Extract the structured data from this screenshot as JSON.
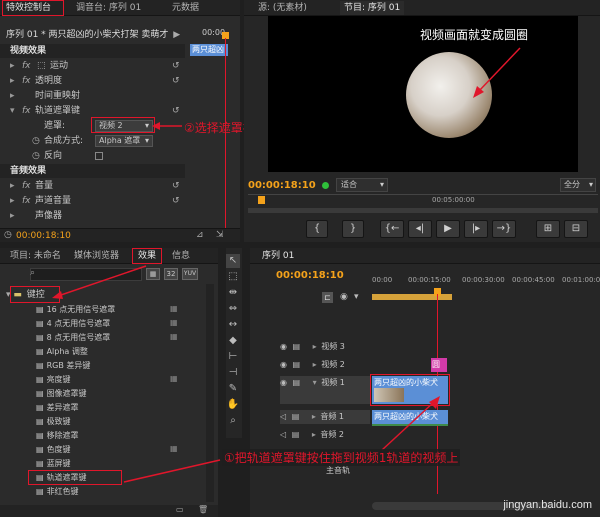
{
  "effect_controls": {
    "tabs": [
      "特效控制台",
      "调音台: 序列 01",
      "元数据"
    ],
    "sequence_label": "序列 01 * 两只超凶的小柴犬打架 卖萌才",
    "timecode_head": "00:00",
    "clip_mini_label": "两只超凶",
    "video_effects_header": "视频效果",
    "motion": "运动",
    "opacity": "透明度",
    "time_remap": "时间重映射",
    "track_matte": "轨道遮罩键",
    "matte_label": "遮罩:",
    "matte_value": "视频 2",
    "composite_label": "合成方式:",
    "composite_value": "Alpha 遮罩",
    "reverse_label": "反向",
    "audio_effects_header": "音频效果",
    "volume": "音量",
    "channel_volume": "声道音量",
    "panner": "声像器",
    "timecode": "00:00:18:10"
  },
  "source_monitor": {
    "tab": "源: (无素材)"
  },
  "program_monitor": {
    "tab": "节目: 序列 01",
    "timecode": "00:00:18:10",
    "fit": "适合",
    "ruler_mid": "00:05:00:00",
    "full": "全分"
  },
  "project_panel": {
    "tabs": [
      "项目: 未命名",
      "媒体浏览器",
      "效果",
      "信息"
    ],
    "folder": "键控",
    "badges": [
      "32",
      "YUV"
    ],
    "items": [
      "16 点无用信号遮罩",
      "4 点无用信号遮罩",
      "8 点无用信号遮罩",
      "Alpha 调整",
      "RGB 差异键",
      "亮度键",
      "图像遮罩键",
      "差异遮罩",
      "极致键",
      "移除遮罩",
      "色度键",
      "蓝屏键",
      "轨道遮罩键",
      "非红色键"
    ]
  },
  "timeline": {
    "tab": "序列 01",
    "timecode": "00:00:18:10",
    "ruler": [
      "00:00",
      "00:00:15:00",
      "00:00:30:00",
      "00:00:45:00",
      "00:01:00:00"
    ],
    "tracks": {
      "video3": "视频 3",
      "video2": "视频 2",
      "video1": "视频 1",
      "audio1": "音频 1",
      "audio2": "音频 2",
      "master": "主音轨"
    },
    "clip_v2": "圆",
    "clip_v1": "两只超凶的小柴犬",
    "clip_a1": "两只超凶的小柴犬"
  },
  "annotations": {
    "circle_note": "视频画面就变成圆圈",
    "step2": "②选择遮罩视频2",
    "step1": "①把轨道遮罩键按住拖到视频1轨道的视频上"
  },
  "watermark": "jingyan.baidu.com",
  "colors": {
    "accent_orange": "#f4a21b",
    "annotation_red": "#e0162b",
    "clip_blue": "#5b8fd6",
    "clip_pink": "#d23aa8",
    "audio_green": "#3f8a4a"
  }
}
